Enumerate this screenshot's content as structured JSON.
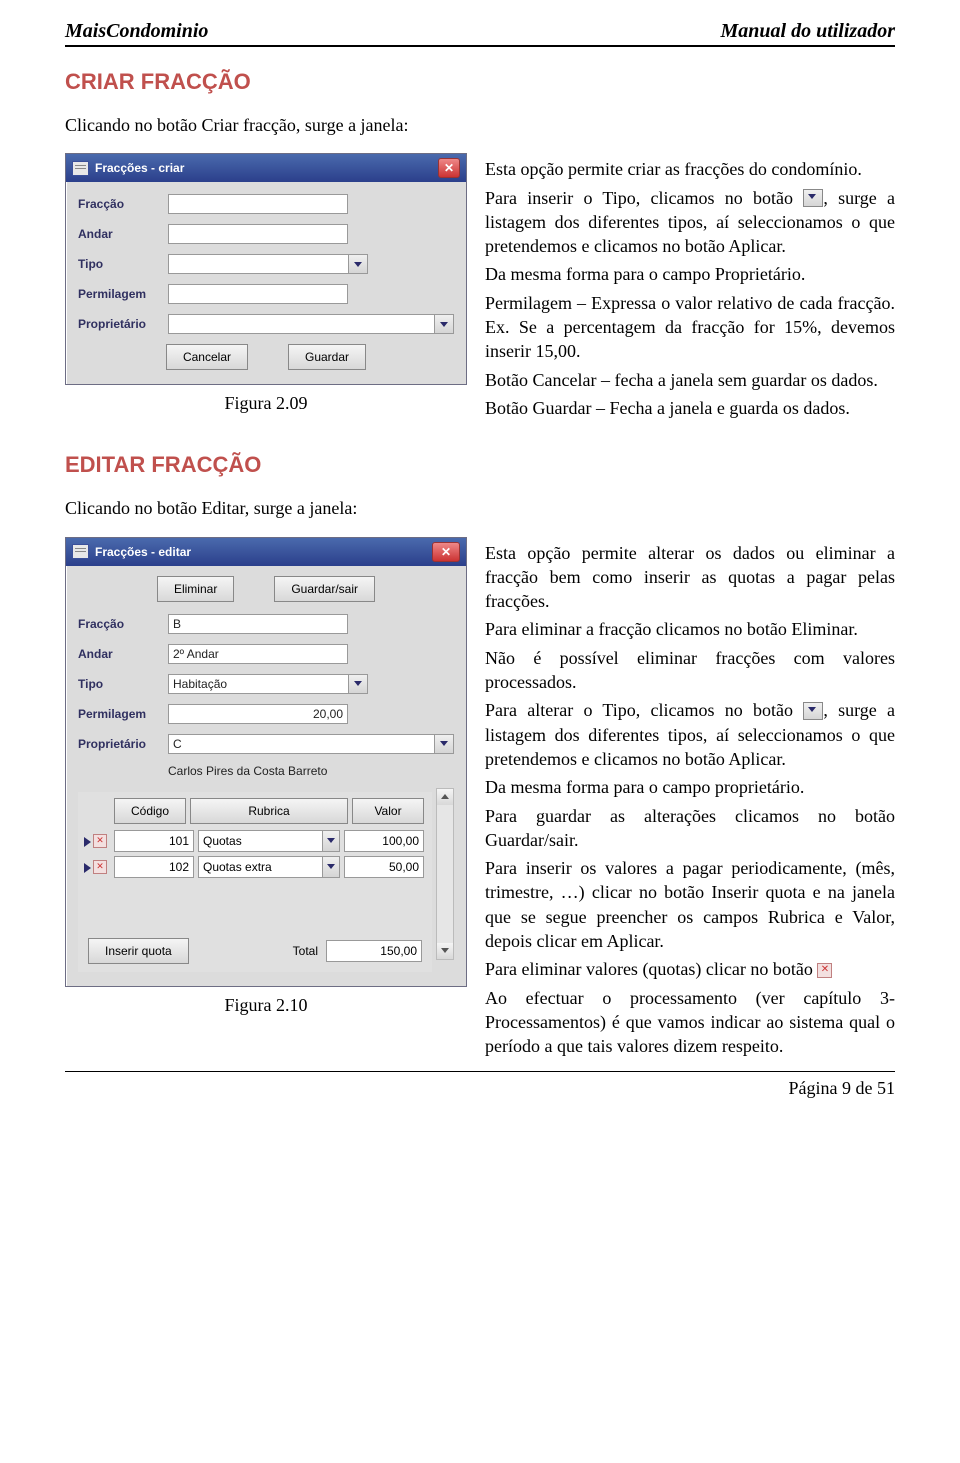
{
  "header": {
    "left": "MaisCondominio",
    "right": "Manual do utilizador"
  },
  "section1": {
    "title": "CRIAR FRACÇÃO",
    "intro": "Clicando no botão Criar fracção, surge a janela:",
    "caption": "Figura 2.09",
    "paras": {
      "p1": "Esta opção permite criar as fracções do condomínio.",
      "p2a": "Para inserir o Tipo, clicamos no botão ",
      "p2b": ", surge a listagem dos diferentes tipos, aí seleccionamos o que pretendemos e clicamos no botão Aplicar.",
      "p3": "Da mesma forma para o campo Proprietário.",
      "p4": "Permilagem – Expressa o valor relativo de cada fracção. Ex. Se a percentagem da fracção for 15%, devemos inserir 15,00.",
      "p5": "Botão Cancelar – fecha a janela sem guardar os dados.",
      "p6": "Botão Guardar – Fecha a janela e guarda os dados."
    }
  },
  "win1": {
    "title": "Fracções - criar",
    "labels": {
      "fraccao": "Fracção",
      "andar": "Andar",
      "tipo": "Tipo",
      "permilagem": "Permilagem",
      "proprietario": "Proprietário"
    },
    "buttons": {
      "cancelar": "Cancelar",
      "guardar": "Guardar"
    }
  },
  "section2": {
    "title": "EDITAR FRACÇÃO",
    "intro": "Clicando no botão Editar, surge a janela:",
    "caption": "Figura 2.10",
    "paras": {
      "p1": "Esta opção permite alterar os dados ou eliminar a fracção bem como inserir as quotas a pagar pelas fracções.",
      "p2": "Para eliminar a fracção clicamos no botão Eliminar.",
      "p3": "Não é possível eliminar fracções com valores processados.",
      "p4a": "Para alterar o Tipo, clicamos no botão ",
      "p4b": ", surge a listagem dos diferentes tipos, aí seleccionamos o que pretendemos e clicamos no botão Aplicar.",
      "p5": "Da mesma forma para o campo proprietário.",
      "p6": "Para guardar as alterações clicamos no botão Guardar/sair.",
      "p7": "Para inserir os valores a pagar periodicamente, (mês, trimestre, …) clicar no botão Inserir quota e na janela que se segue preencher os campos Rubrica e Valor, depois clicar em Aplicar.",
      "p8": "Para eliminar valores (quotas) clicar no botão ",
      "p9": "Ao efectuar o processamento (ver capítulo 3- Processamentos) é que vamos indicar ao sistema qual o período a que tais valores dizem respeito."
    }
  },
  "win2": {
    "title": "Fracções - editar",
    "buttons": {
      "eliminar": "Eliminar",
      "guardar_sair": "Guardar/sair",
      "inserir_quota": "Inserir quota"
    },
    "labels": {
      "fraccao": "Fracção",
      "andar": "Andar",
      "tipo": "Tipo",
      "permilagem": "Permilagem",
      "proprietario": "Proprietário",
      "total": "Total"
    },
    "values": {
      "fraccao": "B",
      "andar": "2º Andar",
      "tipo": "Habitação",
      "permilagem": "20,00",
      "proprietario": "C",
      "proprietario_nome": "Carlos Pires da Costa Barreto",
      "total": "150,00"
    },
    "grid": {
      "headers": {
        "codigo": "Código",
        "rubrica": "Rubrica",
        "valor": "Valor"
      },
      "rows": [
        {
          "codigo": "101",
          "rubrica": "Quotas",
          "valor": "100,00"
        },
        {
          "codigo": "102",
          "rubrica": "Quotas extra",
          "valor": "50,00"
        }
      ]
    }
  },
  "footer": {
    "page": "Página 9 de 51"
  }
}
